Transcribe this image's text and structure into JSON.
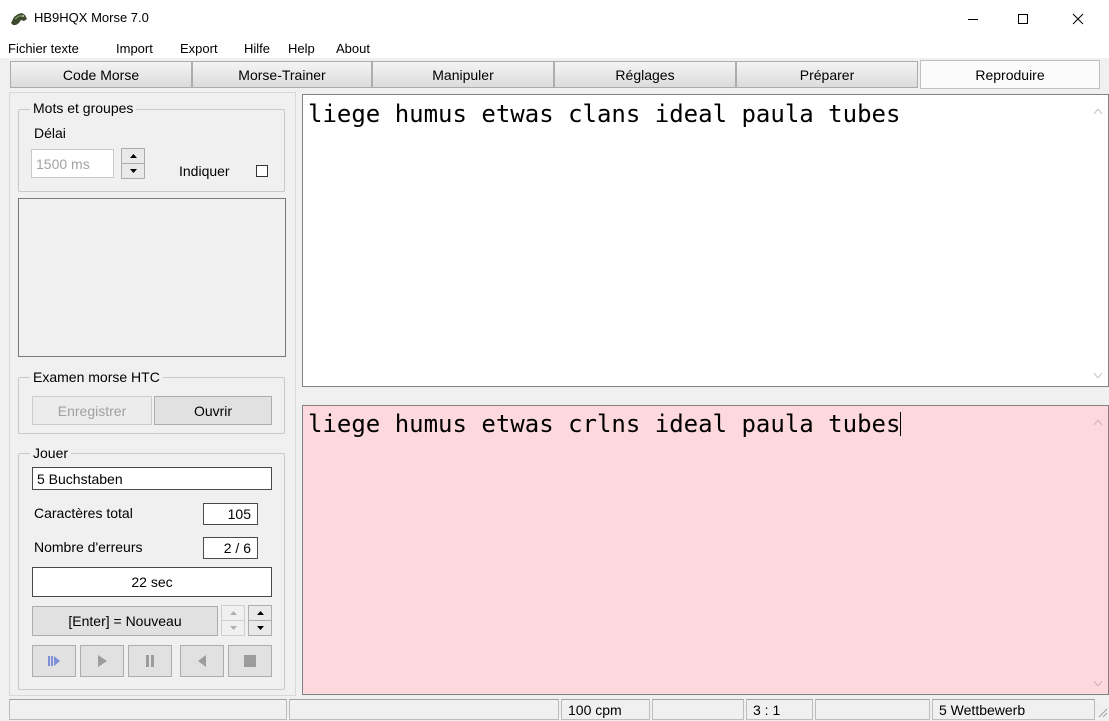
{
  "window": {
    "title": "HB9HQX Morse 7.0"
  },
  "menu": [
    "Fichier texte",
    "Import",
    "Export",
    "Hilfe",
    "Help",
    "About"
  ],
  "tabs": [
    "Code Morse",
    "Morse-Trainer",
    "Manipuler",
    "Réglages",
    "Préparer",
    "Reproduire"
  ],
  "active_tab": "Reproduire",
  "mots_groupes": {
    "legend": "Mots et groupes",
    "delai_label": "Délai",
    "delai_value": "1500 ms",
    "indiquer_label": "Indiquer",
    "indiquer_checked": false
  },
  "examen": {
    "legend": "Examen morse HTC",
    "enregistrer_label": "Enregistrer",
    "ouvrir_label": "Ouvrir"
  },
  "jouer": {
    "legend": "Jouer",
    "mode_value": "5 Buchstaben",
    "caracteres_label": "Caractères total",
    "caracteres_value": "105",
    "erreurs_label": "Nombre d'erreurs",
    "erreurs_value": "2 / 6",
    "timer_value": "22 sec",
    "nouveau_label": "[Enter] = Nouveau"
  },
  "text": {
    "source": "liege humus etwas clans ideal paula tubes",
    "typed": "liege humus etwas crlns ideal paula tubes"
  },
  "statusbar": {
    "speed": "100 cpm",
    "ratio": "3 : 1",
    "mode": "5 Wettbewerb"
  },
  "colors": {
    "typed_bg": "#fdd9de",
    "source_bg": "#ffffff",
    "window_bg": "#f0f0f0"
  }
}
